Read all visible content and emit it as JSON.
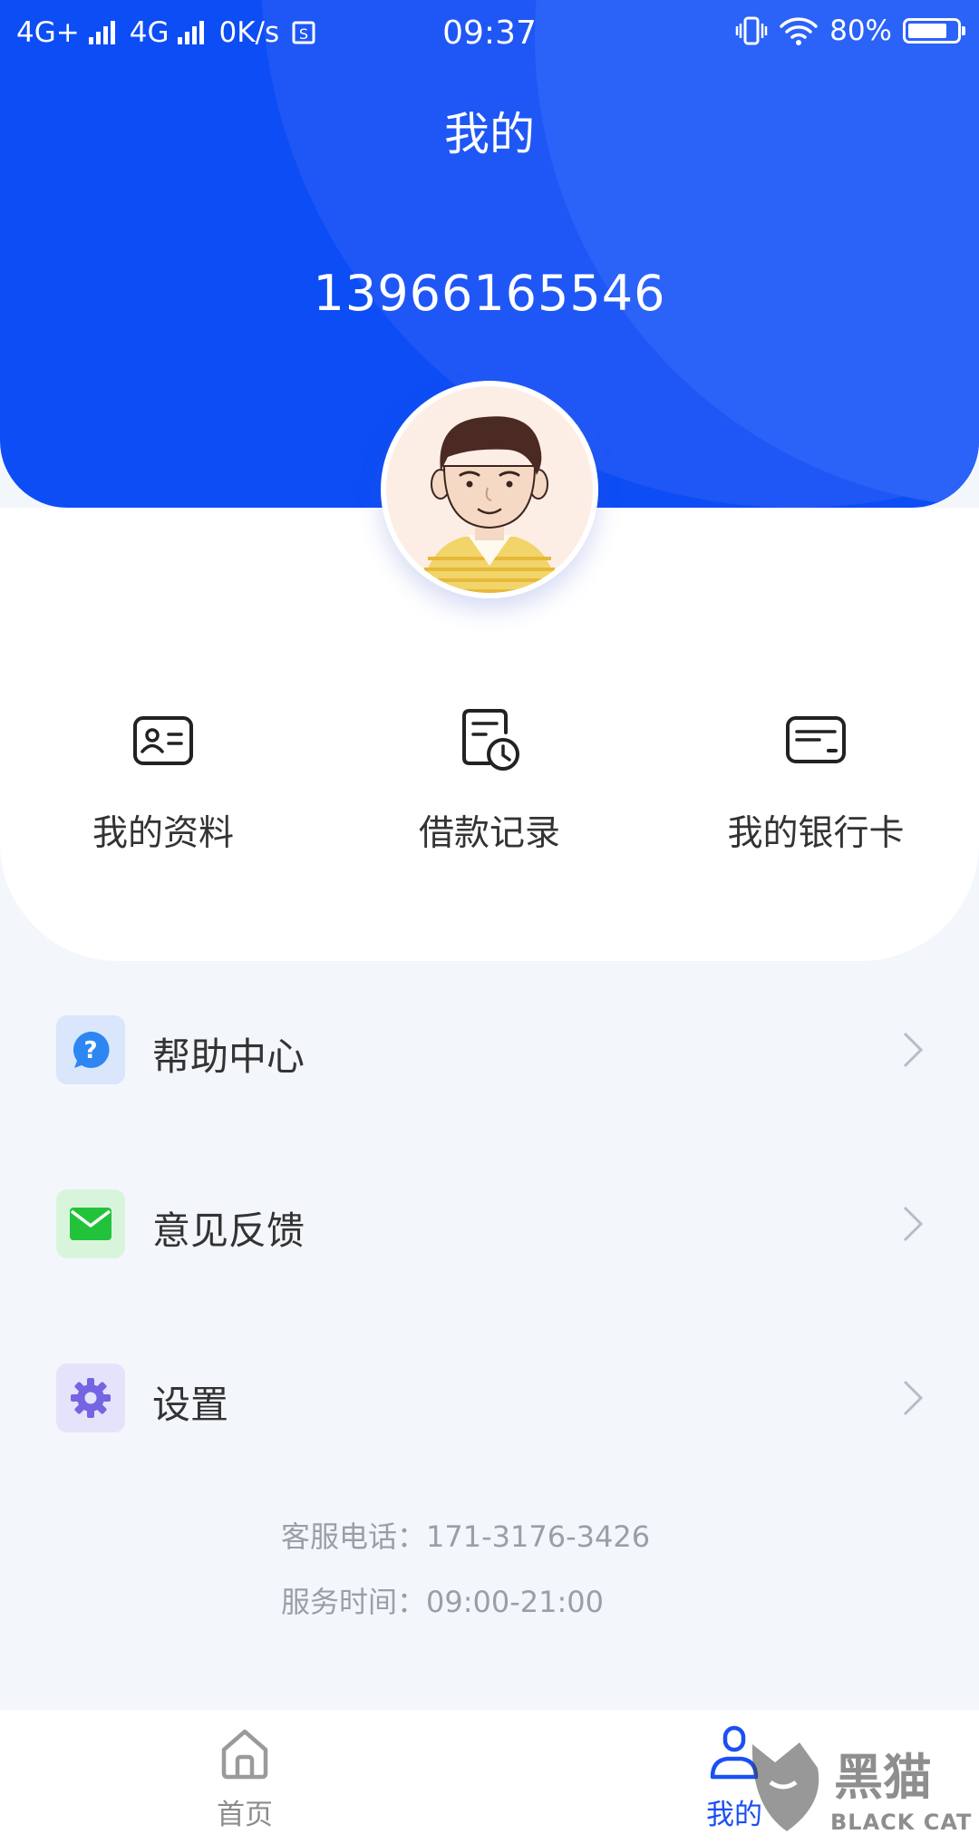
{
  "status_bar": {
    "network1": "4G+",
    "network2": "4G",
    "speed": "0K/s",
    "time": "09:37",
    "battery": "80%",
    "battery_level": 0.8
  },
  "header": {
    "title": "我的",
    "phone": "13966165546",
    "accent_color": "#0d4df5"
  },
  "quick_actions": [
    {
      "label": "我的资料",
      "icon": "id-card-icon"
    },
    {
      "label": "借款记录",
      "icon": "document-clock-icon"
    },
    {
      "label": "我的银行卡",
      "icon": "bank-card-icon"
    }
  ],
  "menu": [
    {
      "label": "帮助中心",
      "icon": "help-question-icon",
      "icon_bg": "#d9e6fb",
      "icon_color": "#2e86f2"
    },
    {
      "label": "意见反馈",
      "icon": "mail-envelope-icon",
      "icon_bg": "#d8f5dc",
      "icon_color": "#22c33a"
    },
    {
      "label": "设置",
      "icon": "settings-gear-icon",
      "icon_bg": "#e5e3fb",
      "icon_color": "#7465e2"
    }
  ],
  "contact": {
    "phone_line": "客服电话：171-3176-3426",
    "hours_line": "服务时间：09:00-21:00"
  },
  "tabs": [
    {
      "label": "首页",
      "icon": "home-icon",
      "active": false
    },
    {
      "label": "我的",
      "icon": "user-profile-icon",
      "active": true
    }
  ],
  "watermark": {
    "brand": "黑猫",
    "sub": "BLACK CAT"
  }
}
